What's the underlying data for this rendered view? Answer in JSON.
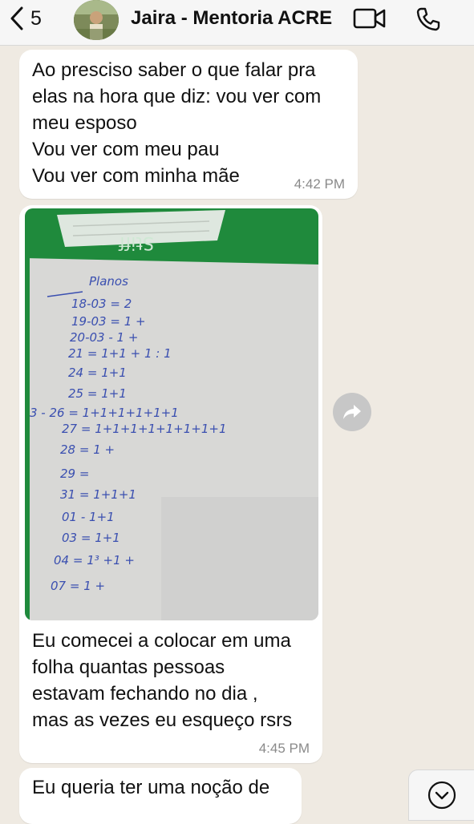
{
  "header": {
    "back_count": "5",
    "title": "Jaira - Mentoria  ACRE",
    "icons": [
      "chevron-left-icon",
      "video-call-icon",
      "phone-call-icon"
    ]
  },
  "messages": [
    {
      "text": "Ao presciso saber o que falar pra\nelas na hora que diz: vou ver com\nmeu esposo\nVou ver com meu pau\nVou ver com minha mãe",
      "time": "4:42 PM"
    },
    {
      "image": {
        "brand": "Stiff",
        "notes": [
          "Planos",
          "18-03 = 2",
          "19-03 = 1 +",
          "20-03 - 1 +",
          "21 = 1+1 + 1 : 1",
          "24 = 1+1",
          "25 = 1+1",
          "3 - 26 = 1+1+1+1+1+1",
          "27 = 1+1+1+1+1+1+1+1",
          "28 = 1 +",
          "29 =",
          "31 = 1+1+1",
          "01 - 1+1",
          "03 = 1+1",
          "04 = 1³ +1 +",
          "07 = 1 +"
        ]
      },
      "text": "Eu comecei a colocar em uma\nfolha quantas pessoas\nestavam fechando no dia ,\nmas as vezes eu esqueço rsrs",
      "time": "4:45 PM"
    },
    {
      "text": "Eu queria ter uma noção de"
    }
  ],
  "colors": {
    "chat_background": "#efeae2",
    "bubble": "#ffffff",
    "header": "#f6f6f6",
    "notebook_green": "#1f8a3c"
  }
}
